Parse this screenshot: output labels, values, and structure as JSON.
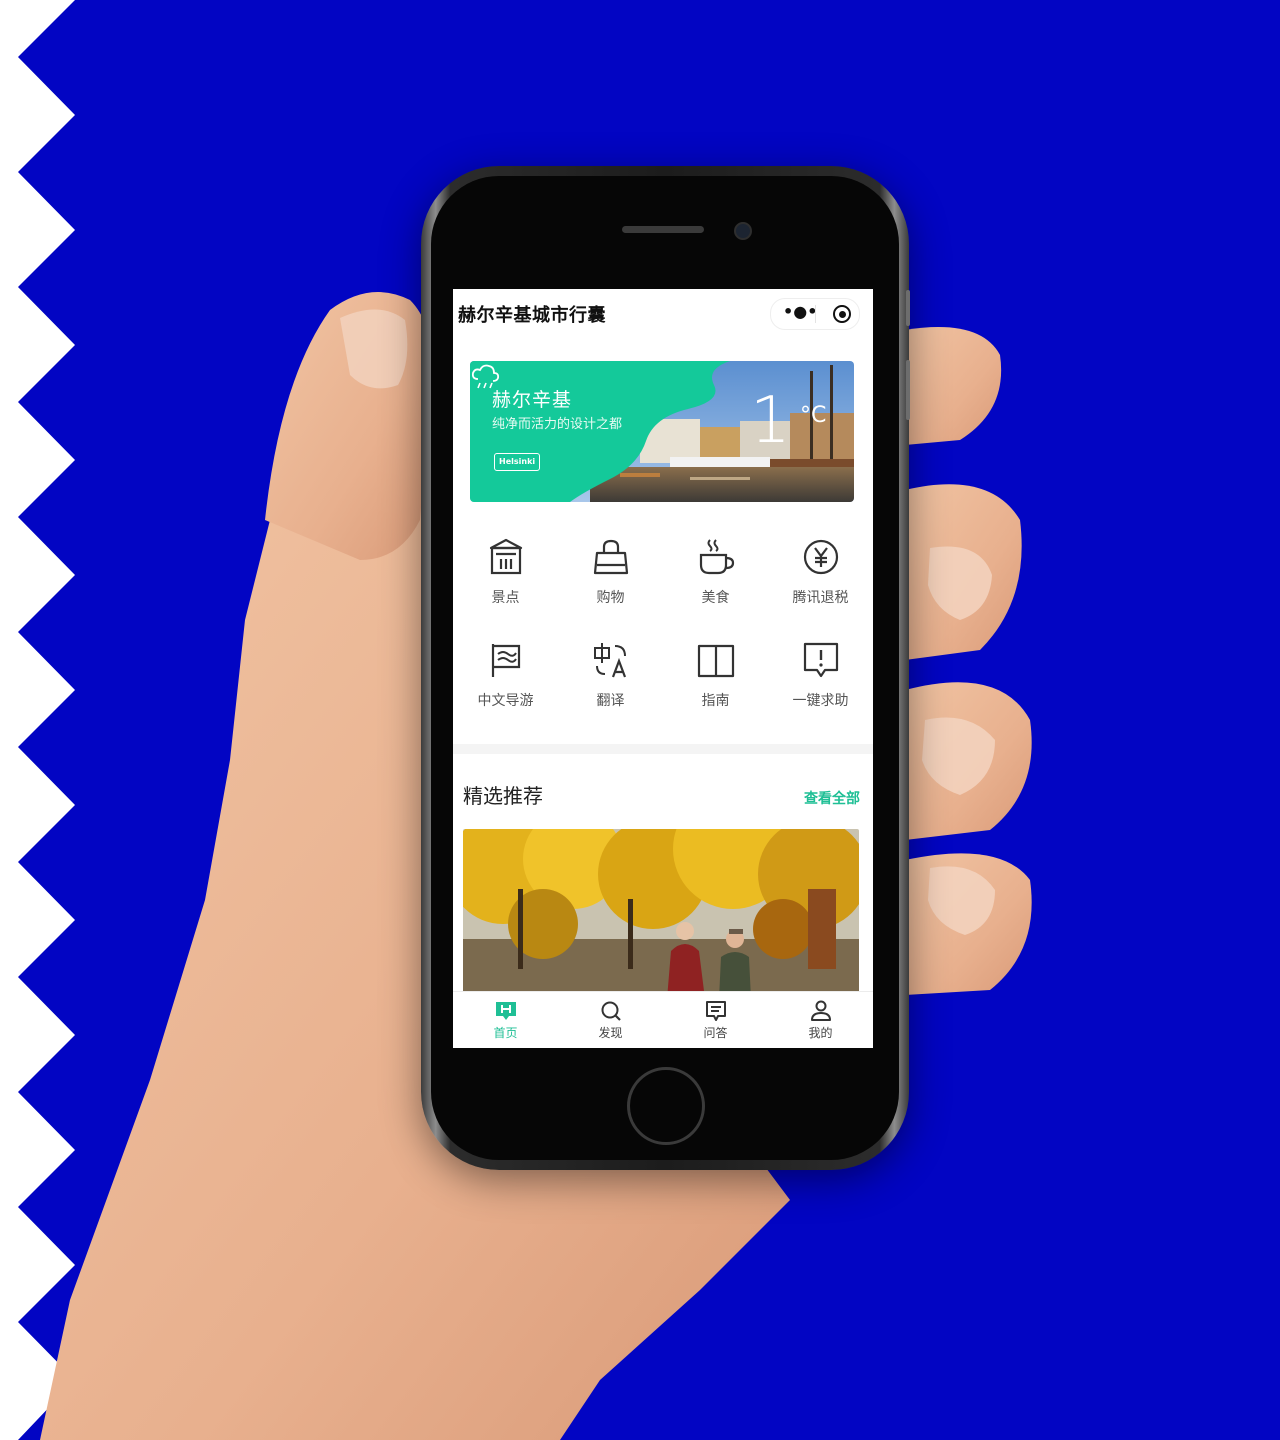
{
  "app": {
    "title": "赫尔辛基城市行囊",
    "capsule": {
      "more_icon": "more-dots-icon",
      "close_icon": "target-icon",
      "more_glyph": "•●•"
    }
  },
  "banner": {
    "city": "赫尔辛基",
    "slogan": "纯净而活力的设计之都",
    "logo_text": "Helsinki",
    "temperature": "1",
    "temperature_unit": "°C",
    "weather_icon": "cloudy-rain-icon"
  },
  "services": [
    {
      "label": "景点",
      "icon": "museum-icon"
    },
    {
      "label": "购物",
      "icon": "shopping-bag-icon"
    },
    {
      "label": "美食",
      "icon": "coffee-cup-icon"
    },
    {
      "label": "腾讯退税",
      "icon": "yen-coin-icon"
    },
    {
      "label": "中文导游",
      "icon": "flag-icon"
    },
    {
      "label": "翻译",
      "icon": "translate-icon"
    },
    {
      "label": "指南",
      "icon": "book-icon"
    },
    {
      "label": "一键求助",
      "icon": "alert-icon"
    }
  ],
  "featured": {
    "title": "精选推荐",
    "see_all": "查看全部"
  },
  "tabbar": [
    {
      "label": "首页",
      "icon": "home-h-icon",
      "active": true
    },
    {
      "label": "发现",
      "icon": "search-icon",
      "active": false
    },
    {
      "label": "问答",
      "icon": "chat-icon",
      "active": false
    },
    {
      "label": "我的",
      "icon": "user-icon",
      "active": false
    }
  ],
  "colors": {
    "background": "#0205c3",
    "accent": "#1fbf95",
    "banner_green": "#14c99a"
  }
}
